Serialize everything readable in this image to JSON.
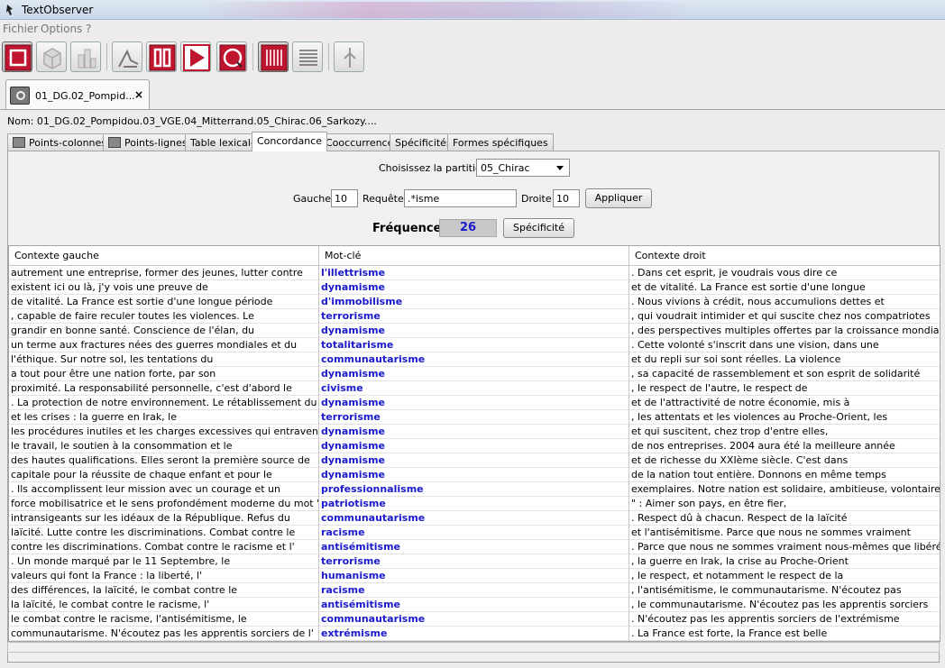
{
  "window": {
    "title": "TextObserver"
  },
  "menu": [
    "Fichier",
    "Options",
    "?"
  ],
  "toolbar": {
    "buttons": [
      {
        "icon": "stop-square-icon",
        "active": true
      },
      {
        "icon": "cube-icon",
        "active": false
      },
      {
        "icon": "chart-icon",
        "active": false
      },
      {
        "icon": "graph-icon",
        "active": false
      },
      {
        "icon": "pause-icon",
        "active": false
      },
      {
        "icon": "play-icon",
        "active": false
      },
      {
        "icon": "record-icon",
        "active": false
      },
      {
        "icon": "columns-icon",
        "active": true
      },
      {
        "icon": "lines-icon",
        "active": false
      },
      {
        "icon": "tool-icon",
        "active": false
      }
    ]
  },
  "document_tab": {
    "label": "01_DG.02_Pompid...",
    "close": "×"
  },
  "nom": "Nom: 01_DG.02_Pompidou.03_VGE.04_Mitterrand.05_Chirac.06_Sarkozy....",
  "tabs": [
    "Points-colonnes",
    "Points-lignes",
    "Table lexicale",
    "Concordance",
    "Cooccurrence",
    "Spécificités",
    "Formes spécifiques"
  ],
  "active_tab": "Concordance",
  "form": {
    "partition_label": "Choisissez la partition",
    "partition_value": "05_Chirac",
    "gauche_label": "Gauche",
    "gauche_value": "10",
    "requete_label": "Requête",
    "requete_value": ".*isme",
    "droite_label": "Droite",
    "droite_value": "10",
    "appliquer": "Appliquer",
    "frequence_label": "Fréquence",
    "frequence_value": "26",
    "specificite": "Spécificité"
  },
  "table": {
    "headers": [
      "Contexte gauche",
      "Mot-clé",
      "Contexte droit"
    ],
    "rows": [
      [
        "autrement une entreprise, former des jeunes, lutter contre",
        "l'illettrisme",
        ". Dans cet esprit, je voudrais vous dire ce"
      ],
      [
        "existent ici ou là, j'y vois une preuve de",
        "dynamisme",
        "et de vitalité. La France est sortie d'une longue"
      ],
      [
        "de vitalité. La France est sortie d'une longue période",
        "d'immobilisme",
        ". Nous vivions à crédit, nous accumulions dettes et"
      ],
      [
        ", capable de faire reculer toutes les violences. Le",
        "terrorisme",
        ", qui voudrait intimider et qui suscite chez nos compatriotes"
      ],
      [
        "grandir en bonne santé. Conscience de l'élan, du",
        "dynamisme",
        ", des perspectives multiples offertes par la croissance mondiale."
      ],
      [
        "un terme aux fractures nées des guerres mondiales et du",
        "totalitarisme",
        ". Cette volonté s'inscrit dans une vision, dans une"
      ],
      [
        "l'éthique. Sur notre sol, les tentations du",
        "communautarisme",
        "et du repli sur soi sont réelles. La violence"
      ],
      [
        "a tout pour être une nation forte, par son",
        "dynamisme",
        ", sa capacité de rassemblement et son esprit de solidarité"
      ],
      [
        "proximité. La responsabilité personnelle, c'est d'abord le",
        "civisme",
        ", le respect de l'autre, le respect de"
      ],
      [
        ". La protection de notre environnement. Le rétablissement du",
        "dynamisme",
        "et de l'attractivité de notre économie, mis à"
      ],
      [
        "et les crises : la guerre en Irak, le",
        "terrorisme",
        ", les attentats et les violences au Proche-Orient, les"
      ],
      [
        "les procédures inutiles et les charges excessives qui entravent leur",
        "dynamisme",
        "et qui suscitent, chez trop d'entre elles,"
      ],
      [
        "le travail, le soutien à la consommation et le",
        "dynamisme",
        "de nos entreprises. 2004 aura été la meilleure année"
      ],
      [
        "des hautes qualifications. Elles seront la première source de",
        "dynamisme",
        "et de richesse du XXIème siècle. C'est dans"
      ],
      [
        "capitale pour la réussite de chaque enfant et pour le",
        "dynamisme",
        "de la nation tout entière. Donnons en même temps"
      ],
      [
        ". Ils accomplissent leur mission avec un courage et un",
        "professionnalisme",
        "exemplaires. Notre nation est solidaire, ambitieuse, volontaire"
      ],
      [
        "force mobilisatrice et le sens profondément moderne du mot \"",
        "patriotisme",
        "\" : Aimer son pays, en être fier,"
      ],
      [
        "intransigeants sur les idéaux de la République. Refus du",
        "communautarisme",
        ". Respect dû à chacun. Respect de la laïcité"
      ],
      [
        "laïcité. Lutte contre les discriminations. Combat contre le",
        "racisme",
        "et l'antisémitisme. Parce que nous ne sommes vraiment"
      ],
      [
        "contre les discriminations. Combat contre le racisme et l'",
        "antisémitisme",
        ". Parce que nous ne sommes vraiment nous-mêmes que libérés"
      ],
      [
        ". Un monde marqué par le 11 Septembre, le",
        "terrorisme",
        ", la guerre en Irak, la crise au Proche-Orient"
      ],
      [
        "valeurs qui font la France : la liberté, l'",
        "humanisme",
        ", le respect, et notamment le respect de la"
      ],
      [
        "des différences, la laïcité, le combat contre le",
        "racisme",
        ", l'antisémitisme, le communautarisme. N'écoutez pas"
      ],
      [
        "la laïcité, le combat contre le racisme, l'",
        "antisémitisme",
        ", le communautarisme. N'écoutez pas les apprentis sorciers"
      ],
      [
        "le combat contre le racisme, l'antisémitisme, le",
        "communautarisme",
        ". N'écoutez pas les apprentis sorciers de l'extrémisme"
      ],
      [
        "communautarisme. N'écoutez pas les apprentis sorciers de l'",
        "extrémisme",
        ". La France est forte, la France est belle"
      ]
    ]
  },
  "colors": {
    "keyword": "#1a1acc",
    "toolbar_red": "#c0152f"
  }
}
